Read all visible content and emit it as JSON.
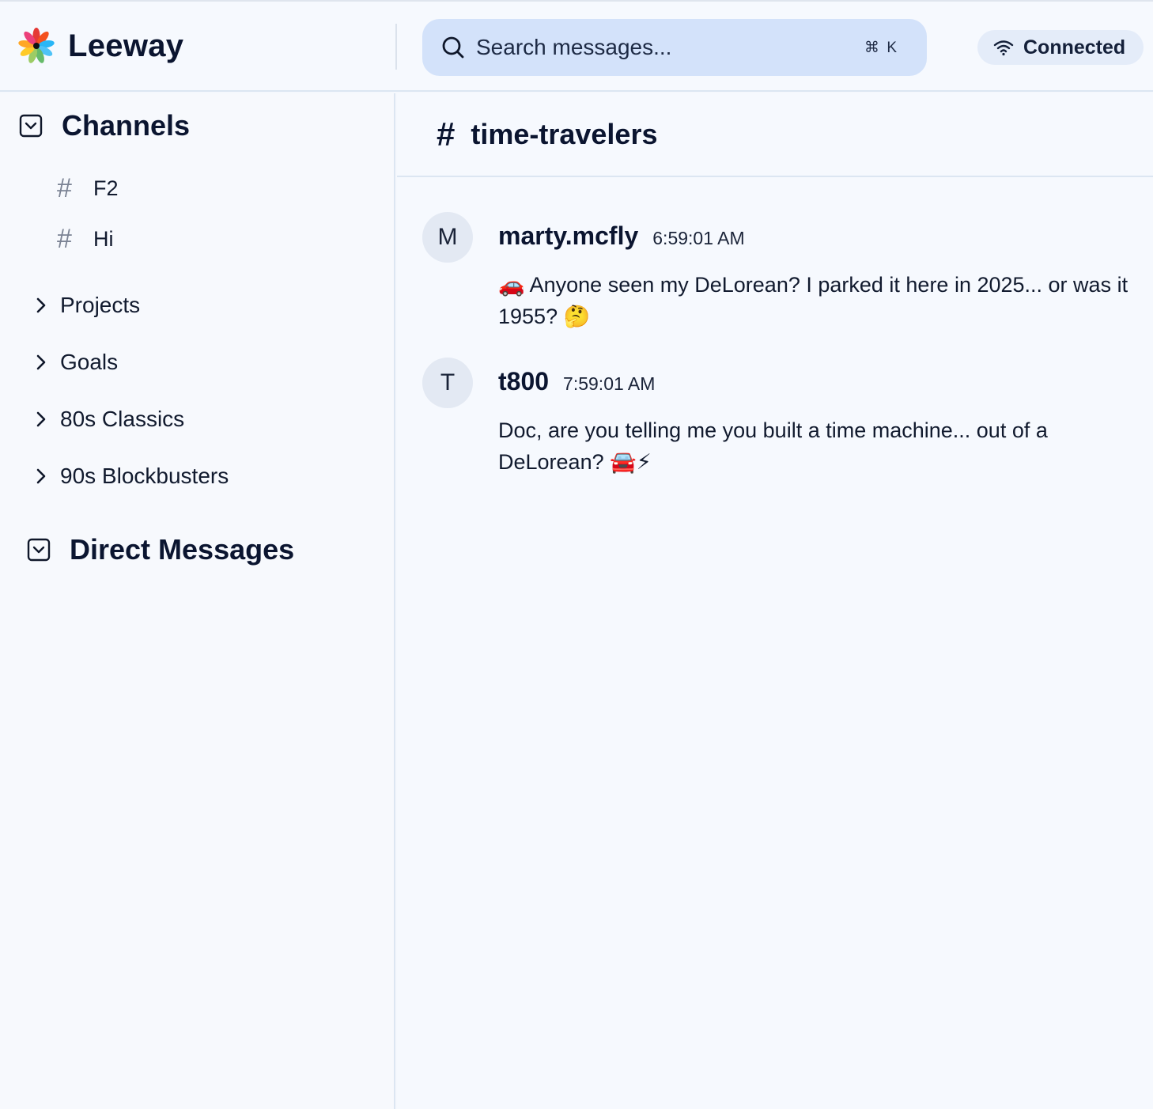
{
  "app": {
    "name": "Leeway"
  },
  "search": {
    "placeholder": "Search messages...",
    "shortcut": "⌘ K"
  },
  "status": {
    "label": "Connected"
  },
  "sidebar": {
    "channels_title": "Channels",
    "channels": [
      {
        "prefix": "#",
        "name": "F2"
      },
      {
        "prefix": "#",
        "name": "Hi"
      }
    ],
    "groups": [
      {
        "name": "Projects"
      },
      {
        "name": "Goals"
      },
      {
        "name": "80s Classics"
      },
      {
        "name": "90s Blockbusters"
      }
    ],
    "dm_title": "Direct Messages"
  },
  "channel": {
    "prefix": "#",
    "title": "time-travelers"
  },
  "messages": [
    {
      "avatar": "M",
      "author": "marty.mcfly",
      "time": "6:59:01 AM",
      "text": "🚗 Anyone seen my DeLorean? I parked it here in 2025... or was it 1955? 🤔"
    },
    {
      "avatar": "T",
      "author": "t800",
      "time": "7:59:01 AM",
      "text": "Doc, are you telling me you built a time machine... out of a DeLorean? 🚘⚡"
    }
  ],
  "icons": {
    "logo": "flower-logo-icon",
    "search": "search-icon",
    "status": "wifi-icon",
    "section_toggle": "collapse-square-icon",
    "group": "chevron-right-icon"
  }
}
